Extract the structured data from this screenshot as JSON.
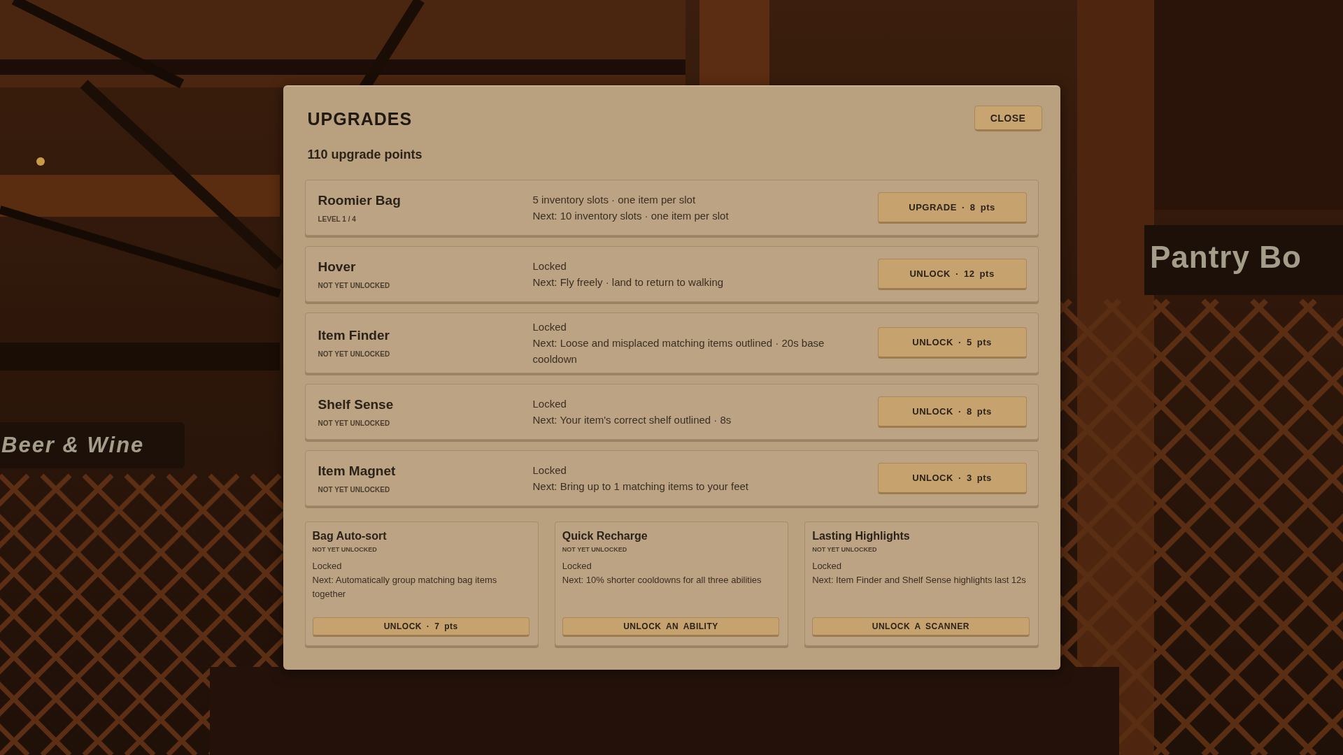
{
  "scene": {
    "signs": [
      {
        "text": "Beer & Wine"
      },
      {
        "text": "Pantry Bo"
      }
    ]
  },
  "dialog": {
    "title": "UPGRADES",
    "close_button": "CLOSE",
    "points": "110 upgrade points",
    "upgrade_rows": [
      {
        "name": "Roomier Bag",
        "status": "LEVEL 1 / 4",
        "current": "5 inventory slots · one item per slot",
        "next": "Next: 10 inventory slots · one item per slot",
        "button": "UPGRADE · 8 pts"
      },
      {
        "name": "Hover",
        "status": "NOT YET UNLOCKED",
        "current": "Locked",
        "next": "Next: Fly freely · land to return to walking",
        "button": "UNLOCK · 12 pts"
      },
      {
        "name": "Item Finder",
        "status": "NOT YET UNLOCKED",
        "current": "Locked",
        "next": "Next: Loose and misplaced matching items outlined · 20s base cooldown",
        "button": "UNLOCK · 5 pts"
      },
      {
        "name": "Shelf Sense",
        "status": "NOT YET UNLOCKED",
        "current": "Locked",
        "next": "Next: Your item's correct shelf outlined · 8s",
        "button": "UNLOCK · 8 pts"
      },
      {
        "name": "Item Magnet",
        "status": "NOT YET UNLOCKED",
        "current": "Locked",
        "next": "Next: Bring up to 1 matching items to your feet",
        "button": "UNLOCK · 3 pts"
      }
    ],
    "upgrade_cards": [
      {
        "name": "Bag Auto-sort",
        "status": "NOT YET UNLOCKED",
        "current": "Locked",
        "next": "Next: Automatically group matching bag items together",
        "button": "UNLOCK · 7 pts"
      },
      {
        "name": "Quick Recharge",
        "status": "NOT YET UNLOCKED",
        "current": "Locked",
        "next": "Next: 10% shorter cooldowns for all three abilities",
        "button": "UNLOCK AN ABILITY"
      },
      {
        "name": "Lasting Highlights",
        "status": "NOT YET UNLOCKED",
        "current": "Locked",
        "next": "Next: Item Finder and Shelf Sense highlights last 12s",
        "button": "UNLOCK A SCANNER"
      }
    ]
  }
}
